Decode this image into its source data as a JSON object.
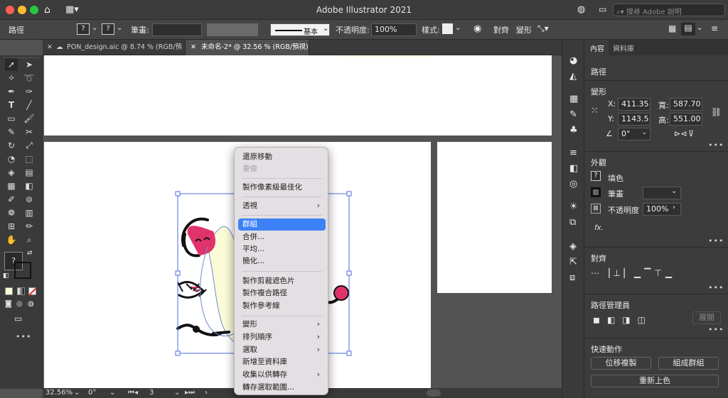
{
  "window": {
    "title": "Adobe Illustrator 2021",
    "search_placeholder": "搜尋 Adobe 說明"
  },
  "controlbar": {
    "selection_label": "路徑",
    "q1": "?",
    "q2": "?",
    "stroke_label": "筆畫:",
    "stroke_style": "基本",
    "opacity_label": "不透明度:",
    "opacity_value": "100%",
    "style_label": "樣式:",
    "align_label": "對齊",
    "transform_label": "變形"
  },
  "tabs": [
    {
      "label": "PON_design.aic @ 8.74 % (RGB/預視)"
    },
    {
      "label": "未命名-2* @ 32.56 % (RGB/預視)"
    }
  ],
  "status": {
    "zoom": "32.56%",
    "angle": "0°",
    "page": "3"
  },
  "context_menu": {
    "undo_move": "還原移動",
    "redo": "重做",
    "pixel_optimize": "製作像素級最佳化",
    "perspective": "透視",
    "group": "群組",
    "join": "合併...",
    "average": "平均...",
    "simplify": "簡化...",
    "make_clipping_mask": "製作剪裁遮色片",
    "make_compound_path": "製作複合路徑",
    "make_guides": "製作參考線",
    "transform": "變形",
    "arrange": "排列順序",
    "select": "選取",
    "add_to_library": "新增至資料庫",
    "collect_for_export": "收集以供轉存",
    "export_selection": "轉存選取範圍..."
  },
  "panel": {
    "tabs": [
      "內容",
      "資料庫"
    ],
    "section_path": "路徑",
    "transform": {
      "title": "變形",
      "x_label": "X:",
      "x_value": "411.35",
      "y_label": "Y:",
      "y_value": "1143.5",
      "w_label": "寬:",
      "w_value": "587.70",
      "h_label": "高:",
      "h_value": "551.00",
      "angle_value": "0°"
    },
    "appearance": {
      "title": "外觀",
      "fill_label": "填色",
      "fill_q": "?",
      "stroke_label": "筆畫",
      "opacity_label": "不透明度",
      "opacity_value": "100%",
      "fx_label": "fx."
    },
    "align": {
      "title": "對齊"
    },
    "pathfinder": {
      "title": "路徑管理員",
      "expand_button": "展開"
    },
    "quick_actions": {
      "title": "快速動作",
      "offset_copy": "位移複製",
      "ungroup": "組成群組",
      "recolor": "重新上色"
    }
  },
  "colors": {
    "accent": "#3c82f6",
    "pink": "#e0336b",
    "cream": "#fbfbd8",
    "selection": "#4a6ee0"
  }
}
